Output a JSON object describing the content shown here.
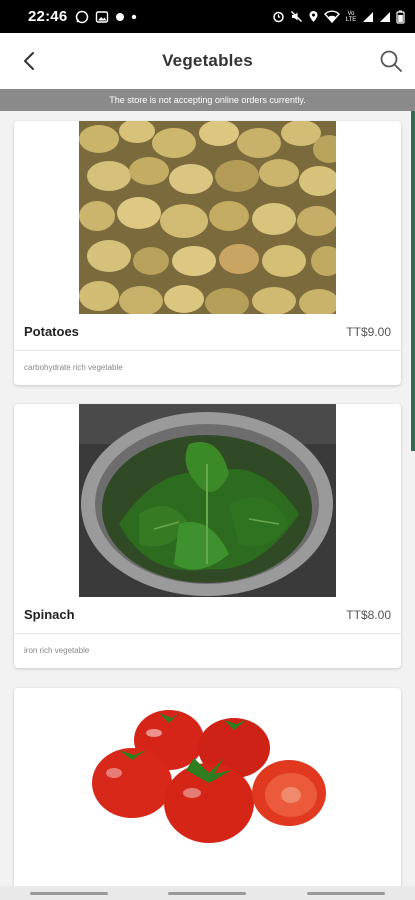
{
  "status_bar": {
    "time": "22:46",
    "left_icons": [
      "whatsapp-icon",
      "image-icon",
      "circle-icon",
      "dot-icon"
    ],
    "right_icons": [
      "alarm-icon",
      "mute-icon",
      "location-icon",
      "wifi-icon",
      "signal-icon",
      "signal-icon",
      "battery-icon"
    ],
    "network_label": "Vo LTE"
  },
  "header": {
    "title": "Vegetables",
    "back_icon": "chevron-left-icon",
    "search_icon": "search-icon"
  },
  "notice": {
    "text": "The store is not accepting online orders currently."
  },
  "products": [
    {
      "name": "Potatoes",
      "price": "TT$9.00",
      "description": "carbohydrate rich vegetable",
      "image": "potatoes-image"
    },
    {
      "name": "Spinach",
      "price": "TT$8.00",
      "description": "iron rich vegetable",
      "image": "spinach-image"
    },
    {
      "name": "",
      "price": "",
      "description": "",
      "image": "tomatoes-image"
    }
  ],
  "colors": {
    "accent": "#2e6b4f",
    "notice_bg": "#8a8a8a",
    "status_bar_bg": "#000000"
  }
}
